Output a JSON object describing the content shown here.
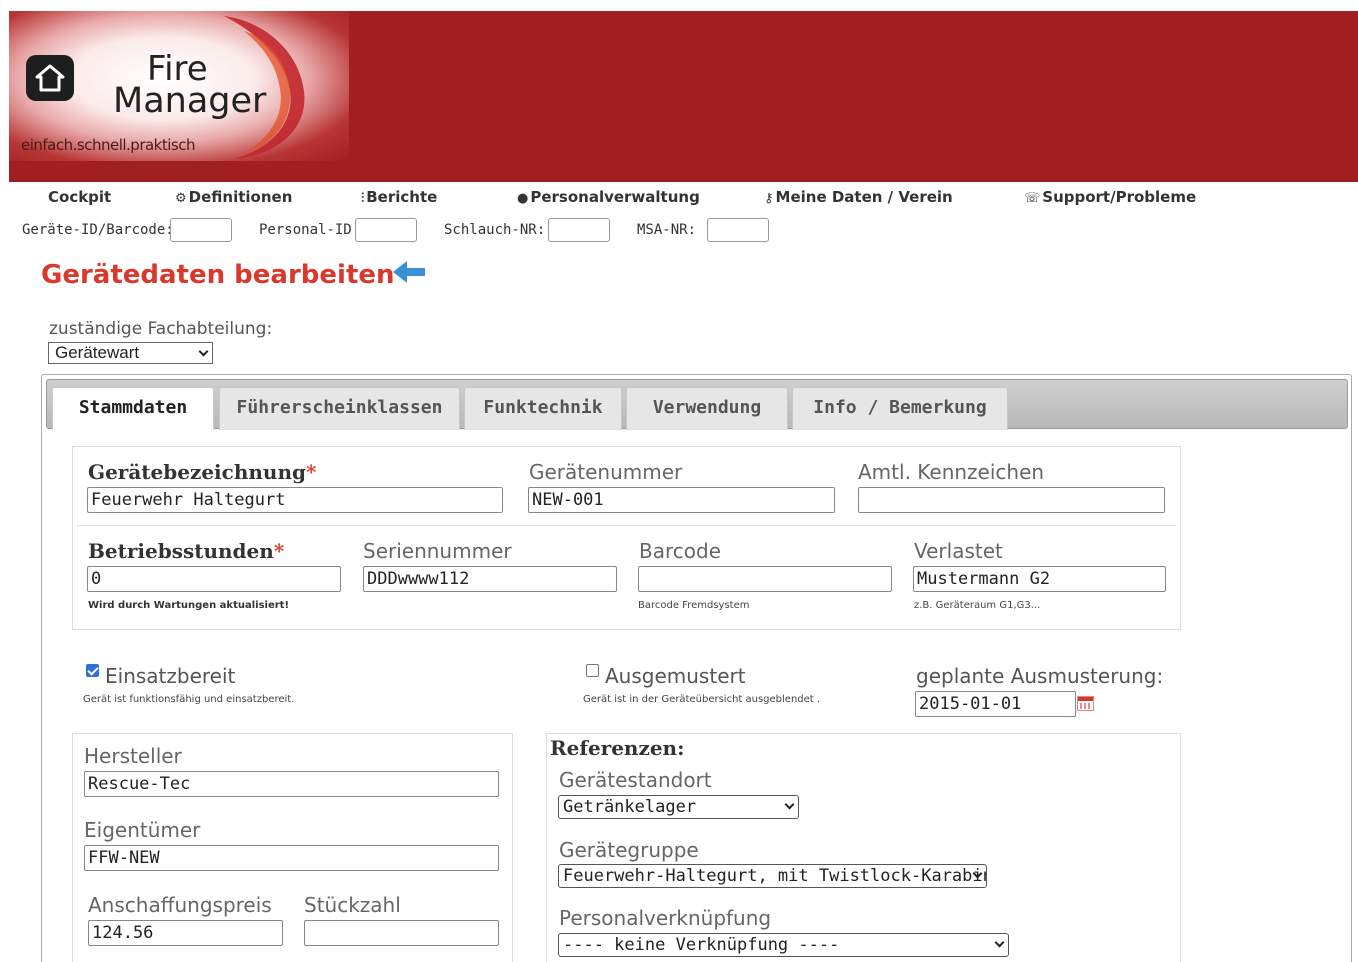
{
  "logo": {
    "line1": "Fire",
    "line2": "Manager",
    "tagline": "einfach.schnell.praktisch"
  },
  "nav": {
    "cockpit": "Cockpit",
    "definitionen": "Definitionen",
    "berichte": "Berichte",
    "personalverwaltung": "Personalverwaltung",
    "meine_daten": "Meine Daten / Verein",
    "support": "Support/Probleme"
  },
  "quick_search": {
    "geraete_id_label": "Geräte-ID/Barcode:",
    "personal_id_label": "Personal-ID:",
    "schlauch_label": "Schlauch-NR:",
    "msa_label": "MSA-NR:"
  },
  "page": {
    "title": "Gerätedaten bearbeiten",
    "dept_label": "zuständige Fachabteilung:",
    "dept_value": "Gerätewart"
  },
  "tabs": [
    "Stammdaten",
    "Führerscheinklassen",
    "Funktechnik",
    "Verwendung",
    "Info / Bemerkung"
  ],
  "form": {
    "geraetebezeichnung": {
      "label": "Gerätebezeichnung",
      "required": "*",
      "value": "Feuerwehr Haltegurt"
    },
    "geraetenummer": {
      "label": "Gerätenummer",
      "value": "NEW-001"
    },
    "kennzeichen": {
      "label": "Amtl. Kennzeichen",
      "value": ""
    },
    "betriebsstunden": {
      "label": "Betriebsstunden",
      "required": "*",
      "value": "0",
      "hint": "Wird durch Wartungen aktualisiert!"
    },
    "seriennummer": {
      "label": "Seriennummer",
      "value": "DDDwwww112"
    },
    "barcode": {
      "label": "Barcode",
      "value": "",
      "hint": "Barcode Fremdsystem"
    },
    "verlastet": {
      "label": "Verlastet",
      "value": "Mustermann G2",
      "hint": "z.B. Geräteraum G1,G3..."
    },
    "einsatzbereit": {
      "label": "Einsatzbereit",
      "checked": true,
      "hint": "Gerät ist funktionsfähig und einsatzbereit."
    },
    "ausgemustert": {
      "label": "Ausgemustert",
      "checked": false,
      "hint": "Gerät ist in der Geräteübersicht ausgeblendet ."
    },
    "ausmusterung": {
      "label": "geplante Ausmusterung:",
      "value": "2015-01-01"
    },
    "hersteller": {
      "label": "Hersteller",
      "value": "Rescue-Tec"
    },
    "eigentuemer": {
      "label": "Eigentümer",
      "value": "FFW-NEW"
    },
    "anschaffungspreis": {
      "label": "Anschaffungspreis",
      "value": "124.56"
    },
    "stueckzahl": {
      "label": "Stückzahl",
      "value": ""
    }
  },
  "referenzen": {
    "title": "Referenzen:",
    "standort": {
      "label": "Gerätestandort",
      "value": "Getränkelager"
    },
    "gruppe": {
      "label": "Gerätegruppe",
      "value": "Feuerwehr-Haltegurt, mit Twistlock-Karabiner"
    },
    "personal": {
      "label": "Personalverknüpfung",
      "value": "---- keine Verknüpfung ----"
    }
  },
  "colors": {
    "header_red": "#a01f21",
    "title_red": "#d9382c",
    "checkbox_blue": "#2a73d9"
  }
}
